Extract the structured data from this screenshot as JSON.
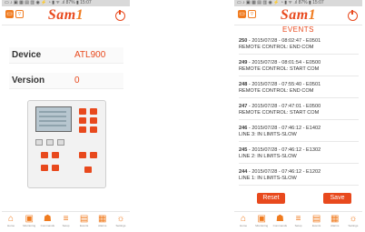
{
  "left": {
    "status": "▭ ♪ ▣ ▦ ▤ ▥ ◉ ⚡ ◔ ▮ ᯤ .ıl 87% ▮ 15:07",
    "device_label": "Device",
    "device_value": "ATL900",
    "version_label": "Version",
    "version_value": "0",
    "nav": [
      {
        "icon": "⌂",
        "label": "Home"
      },
      {
        "icon": "▣",
        "label": "Monitoring"
      },
      {
        "icon": "☗",
        "label": "Commands"
      },
      {
        "icon": "≡",
        "label": "Setup"
      },
      {
        "icon": "▤",
        "label": "Events"
      },
      {
        "icon": "▦",
        "label": "Alarms"
      },
      {
        "icon": "☼",
        "label": "Settings"
      }
    ]
  },
  "right": {
    "status": "▭ ♪ ▣ ▦ ▤ ▥ ◉ ⚡ ◔ ▮ ᯤ .ıl 87% ▮ 15:07",
    "title": "EVENTS",
    "events": [
      {
        "num": "250",
        "meta": " - 2015/07/28 - 08:02:47 - E0501",
        "desc": "REMOTE CONTROL: END COM"
      },
      {
        "num": "249",
        "meta": " - 2015/07/28 - 08:01:54 - E0500",
        "desc": "REMOTE CONTROL: START COM"
      },
      {
        "num": "248",
        "meta": " - 2015/07/28 - 07:55:40 - E0501",
        "desc": "REMOTE CONTROL: END COM"
      },
      {
        "num": "247",
        "meta": " - 2015/07/28 - 07:47:01 - E0500",
        "desc": "REMOTE CONTROL: START COM"
      },
      {
        "num": "246",
        "meta": " - 2015/07/28 - 07:46:12 - E1402",
        "desc": "LINE 3: IN LIMITS-SLOW"
      },
      {
        "num": "245",
        "meta": " - 2015/07/28 - 07:46:12 - E1302",
        "desc": "LINE 2: IN LIMITS-SLOW"
      },
      {
        "num": "244",
        "meta": " - 2015/07/28 - 07:46:12 - E1202",
        "desc": "LINE 1: IN LIMITS-SLOW"
      }
    ],
    "reset_label": "Reset",
    "save_label": "Save",
    "nav": [
      {
        "icon": "⌂",
        "label": "Home"
      },
      {
        "icon": "▣",
        "label": "Monitoring"
      },
      {
        "icon": "☗",
        "label": "Commands"
      },
      {
        "icon": "≡",
        "label": "Setup"
      },
      {
        "icon": "▤",
        "label": "Events"
      },
      {
        "icon": "▦",
        "label": "Alarms"
      },
      {
        "icon": "☼",
        "label": "Settings"
      }
    ]
  },
  "brand": {
    "logo_main": "Sam",
    "logo_accent": "1"
  },
  "colors": {
    "accent": "#e8491d",
    "accent_light": "#f07b1f"
  }
}
